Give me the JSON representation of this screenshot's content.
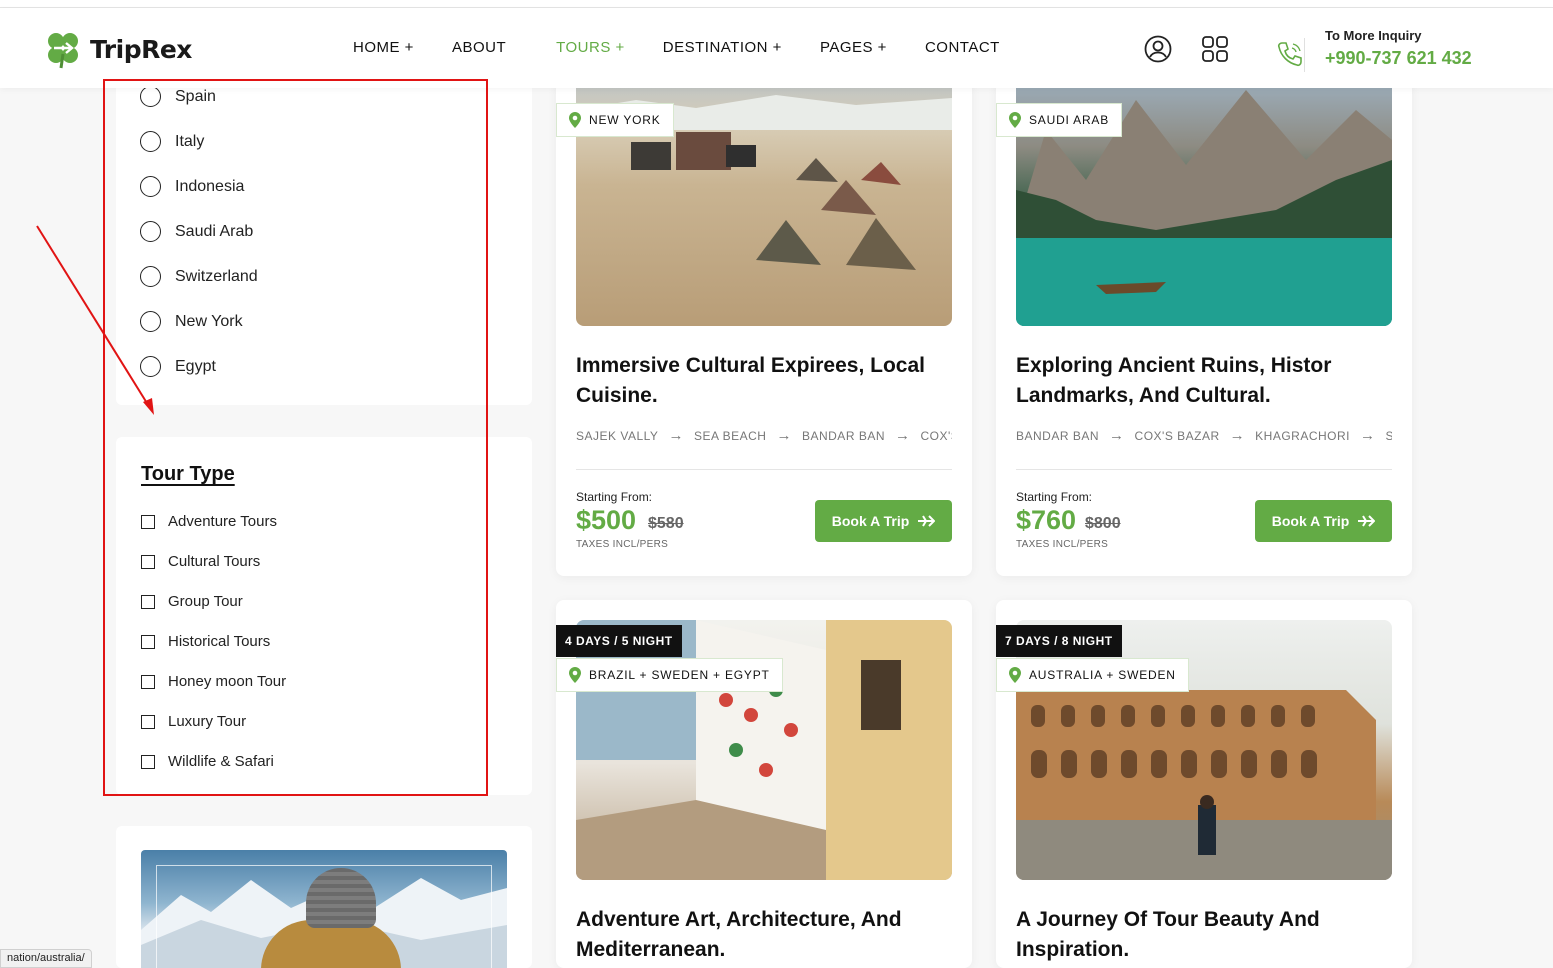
{
  "header": {
    "logo_text": "TripRex",
    "nav": [
      {
        "label": "HOME +"
      },
      {
        "label": "ABOUT"
      },
      {
        "label": "TOURS +"
      },
      {
        "label": "DESTINATION +"
      },
      {
        "label": "PAGES +"
      },
      {
        "label": "CONTACT"
      }
    ],
    "inquiry_label": "To More Inquiry",
    "inquiry_phone": "+990-737 621 432"
  },
  "sidebar": {
    "destinations": [
      "Spain",
      "Italy",
      "Indonesia",
      "Saudi Arab",
      "Switzerland",
      "New York",
      "Egypt"
    ],
    "tour_type_title": "Tour Type",
    "tour_types": [
      "Adventure Tours",
      "Cultural Tours",
      "Group Tour",
      "Historical Tours",
      "Honey moon Tour",
      "Luxury Tour",
      "Wildlife & Safari"
    ]
  },
  "status_bar_url": "nation/australia/",
  "tours": [
    {
      "location": "NEW YORK",
      "title": "Immersive Cultural Expirees, Local Cuisine.",
      "route": [
        "SAJEK VALLY",
        "SEA BEACH",
        "BANDAR BAN",
        "COX'S"
      ],
      "starting_label": "Starting From:",
      "price": "$500",
      "old_price": "$580",
      "taxes": "TAXES INCL/PERS",
      "button": "Book A Trip"
    },
    {
      "location": "SAUDI ARAB",
      "title": "Exploring Ancient Ruins, Histor Landmarks, And Cultural.",
      "route": [
        "BANDAR BAN",
        "COX'S BAZAR",
        "KHAGRACHORI",
        "SA"
      ],
      "starting_label": "Starting From:",
      "price": "$760",
      "old_price": "$800",
      "taxes": "TAXES INCL/PERS",
      "button": "Book A Trip"
    },
    {
      "days": "4 DAYS / 5 NIGHT",
      "location": "BRAZIL + SWEDEN + EGYPT",
      "title": "Adventure Art, Architecture, And Mediterranean."
    },
    {
      "days": "7 DAYS / 8 NIGHT",
      "location": "AUSTRALIA + SWEDEN",
      "title": "A Journey Of Tour Beauty And Inspiration."
    }
  ],
  "colors": {
    "accent": "#63ab45",
    "annotation": "#e11414"
  }
}
